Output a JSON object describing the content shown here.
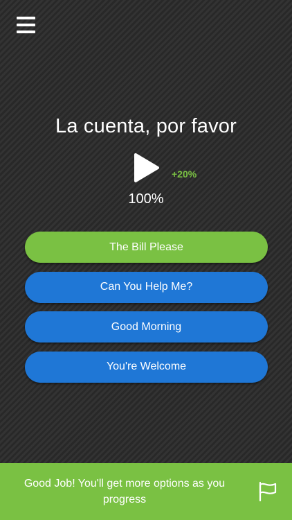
{
  "header": {
    "menu_icon": "hamburger-menu-icon"
  },
  "quiz": {
    "phrase": "La cuenta, por favor",
    "play_icon": "play-icon",
    "bonus": "+20%",
    "progress": "100%",
    "options": [
      {
        "label": "The Bill Please",
        "state": "correct"
      },
      {
        "label": "Can You Help Me?",
        "state": "normal"
      },
      {
        "label": "Good Morning",
        "state": "normal"
      },
      {
        "label": "You're Welcome",
        "state": "normal"
      }
    ]
  },
  "footer": {
    "message": "Good Job! You'll get more options as you progress",
    "flag_icon": "flag-icon"
  },
  "colors": {
    "accent_green": "#7ac143",
    "option_blue": "#1f77d6",
    "background": "#2e2e2e"
  }
}
